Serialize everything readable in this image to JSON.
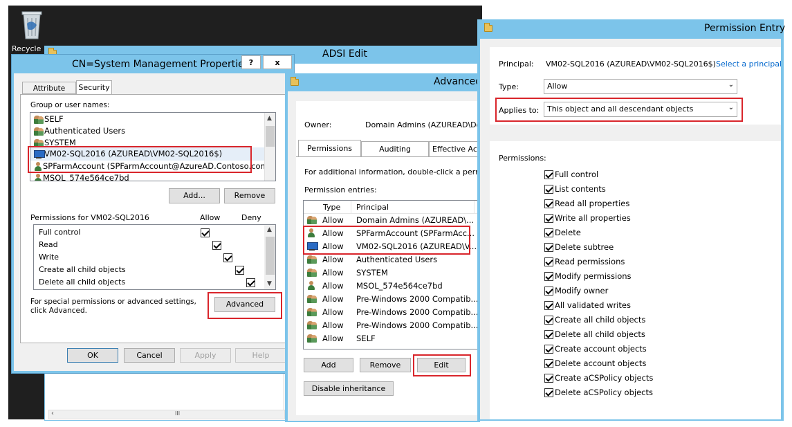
{
  "desktop": {
    "recycle_label": "Recycle"
  },
  "adsi": {
    "title": "ADSI Edit",
    "scroll_glyph": "III"
  },
  "cn_dialog": {
    "title": "CN=System Management Properties",
    "help_btn": "?",
    "close_btn": "x",
    "tabs": [
      "Attribute Editor",
      "Security"
    ],
    "group_label": "Group or user names:",
    "users": [
      {
        "name": "SELF",
        "icon": "group-icon"
      },
      {
        "name": "Authenticated Users",
        "icon": "group-icon"
      },
      {
        "name": "SYSTEM",
        "icon": "group-icon"
      },
      {
        "name": "VM02-SQL2016 (AZUREAD\\VM02-SQL2016$)",
        "icon": "computer-icon"
      },
      {
        "name": "SPFarmAccount (SPFarmAccount@AzureAD.Contoso.com)",
        "icon": "user-icon"
      },
      {
        "name": "MSOL_574e564ce7bd",
        "icon": "user-icon"
      }
    ],
    "add_btn": "Add...",
    "remove_btn": "Remove",
    "perm_for": "Permissions for VM02-SQL2016",
    "allow_col": "Allow",
    "deny_col": "Deny",
    "perms": [
      {
        "name": "Full control",
        "allow": true,
        "deny": false
      },
      {
        "name": "Read",
        "allow": true,
        "deny": false
      },
      {
        "name": "Write",
        "allow": true,
        "deny": false
      },
      {
        "name": "Create all child objects",
        "allow": true,
        "deny": false
      },
      {
        "name": "Delete all child objects",
        "allow": true,
        "deny": false
      }
    ],
    "special_text": "For special permissions or advanced settings, click Advanced.",
    "advanced_btn": "Advanced",
    "ok_btn": "OK",
    "cancel_btn": "Cancel",
    "apply_btn": "Apply",
    "help_bottom_btn": "Help"
  },
  "advanced": {
    "title": "Advanced",
    "owner_label": "Owner:",
    "owner_value": "Domain Admins (AZUREAD\\Do",
    "tabs": [
      "Permissions",
      "Auditing",
      "Effective Acc"
    ],
    "info": "For additional information, double-click a perm",
    "entries_label": "Permission entries:",
    "col_type": "Type",
    "col_principal": "Principal",
    "entries": [
      {
        "type": "Allow",
        "principal": "Domain Admins (AZUREAD\\...",
        "icon": "group-icon"
      },
      {
        "type": "Allow",
        "principal": "SPFarmAccount (SPFarmAcc...",
        "icon": "user-icon"
      },
      {
        "type": "Allow",
        "principal": "VM02-SQL2016 (AZUREAD\\V...",
        "icon": "computer-icon"
      },
      {
        "type": "Allow",
        "principal": "Authenticated Users",
        "icon": "group-icon"
      },
      {
        "type": "Allow",
        "principal": "SYSTEM",
        "icon": "group-icon"
      },
      {
        "type": "Allow",
        "principal": "MSOL_574e564ce7bd",
        "icon": "user-icon"
      },
      {
        "type": "Allow",
        "principal": "Pre-Windows 2000 Compatib...",
        "icon": "group-icon"
      },
      {
        "type": "Allow",
        "principal": "Pre-Windows 2000 Compatib...",
        "icon": "group-icon"
      },
      {
        "type": "Allow",
        "principal": "Pre-Windows 2000 Compatib...",
        "icon": "group-icon"
      },
      {
        "type": "Allow",
        "principal": "SELF",
        "icon": "group-icon"
      }
    ],
    "add_btn": "Add",
    "remove_btn": "Remove",
    "edit_btn": "Edit",
    "disable_btn": "Disable inheritance"
  },
  "entry": {
    "title": "Permission Entry",
    "principal_label": "Principal:",
    "principal_value": "VM02-SQL2016 (AZUREAD\\VM02-SQL2016$)",
    "select_link": "Select a principal",
    "type_label": "Type:",
    "type_value": "Allow",
    "applies_label": "Applies to:",
    "applies_value": "This object and all descendant objects",
    "perms_label": "Permissions:",
    "perms": [
      "Full control",
      "List contents",
      "Read all properties",
      "Write all properties",
      "Delete",
      "Delete subtree",
      "Read permissions",
      "Modify permissions",
      "Modify owner",
      "All validated writes",
      "Create all child objects",
      "Delete all child objects",
      "Create account objects",
      "Delete account objects",
      "Create aCSPolicy objects",
      "Delete aCSPolicy objects"
    ]
  }
}
